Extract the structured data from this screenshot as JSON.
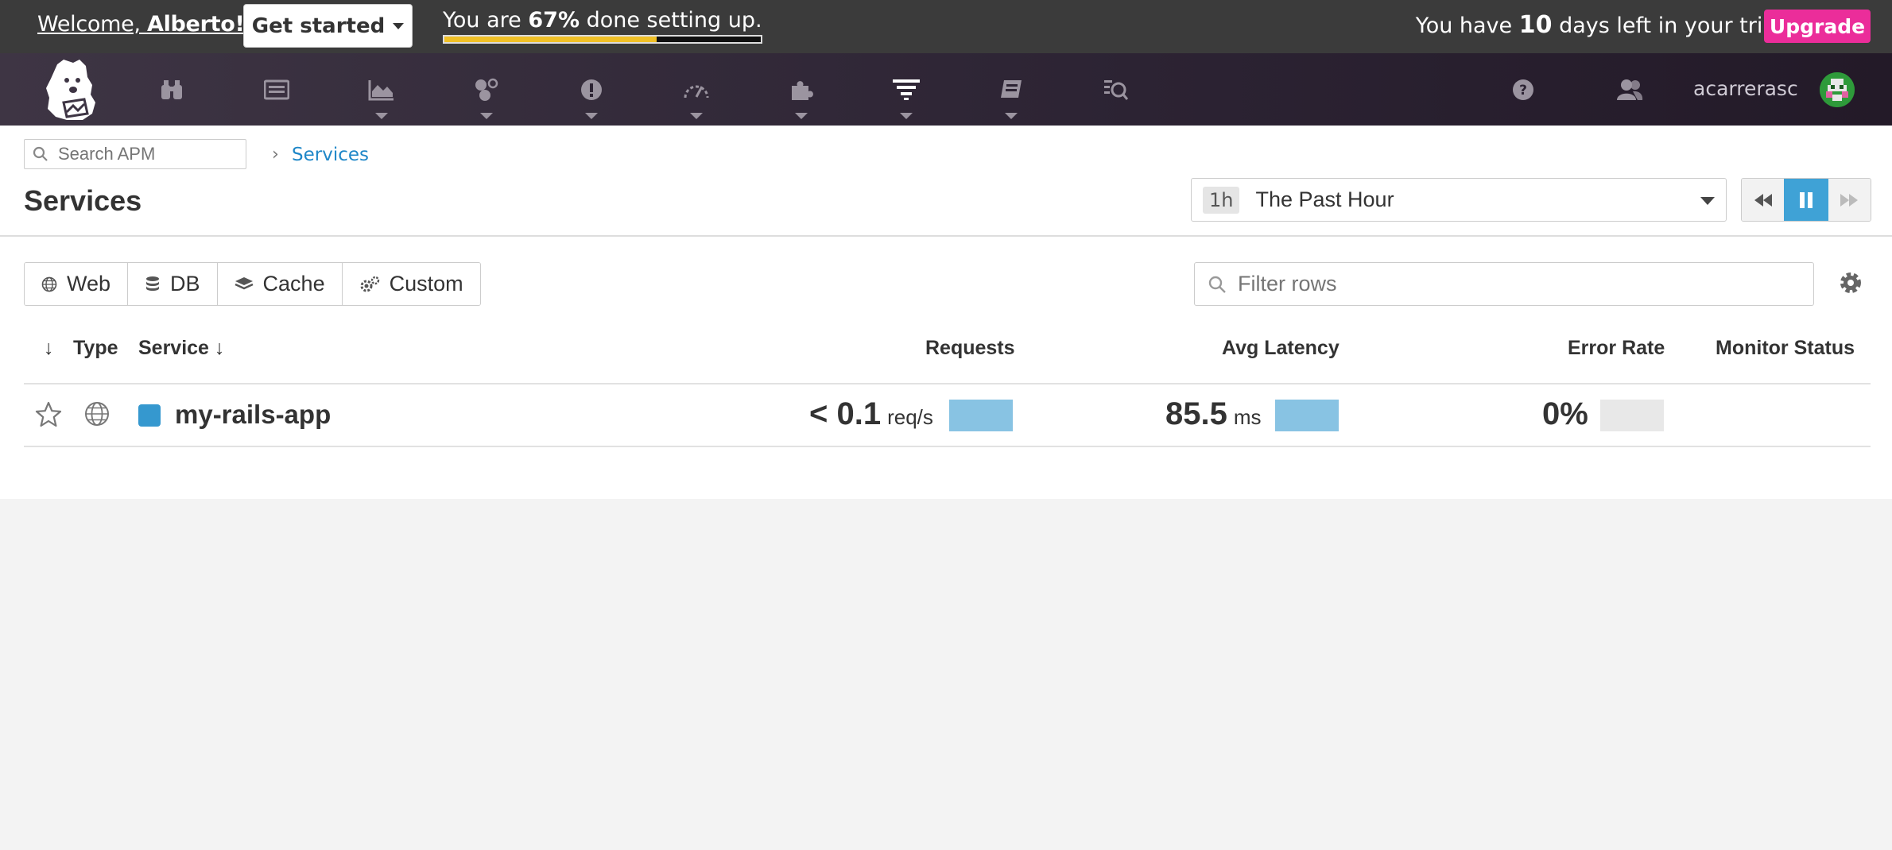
{
  "trial_bar": {
    "welcome_prefix": "Welcome, ",
    "welcome_name": "Alberto!",
    "get_started_label": "Get started",
    "setup_prefix": "You are ",
    "setup_percent": "67%",
    "setup_suffix": " done setting up.",
    "setup_progress_fraction": 0.67,
    "trial_prefix": "You have ",
    "trial_days": "10",
    "trial_suffix": " days left in your trial.",
    "upgrade_label": "Upgrade",
    "upgrade_color": "#eb2d9a",
    "progress_color": "#f0c026"
  },
  "nav": {
    "items": [
      {
        "icon": "binoculars-icon",
        "dropdown": false
      },
      {
        "icon": "dashboard-list-icon",
        "dropdown": true
      },
      {
        "icon": "area-chart-icon",
        "dropdown": true
      },
      {
        "icon": "infrastructure-hexagons-icon",
        "dropdown": true
      },
      {
        "icon": "monitors-alert-icon",
        "dropdown": true
      },
      {
        "icon": "speedometer-icon",
        "dropdown": true
      },
      {
        "icon": "puzzle-integrations-icon",
        "dropdown": true
      },
      {
        "icon": "apm-filter-lines-icon",
        "dropdown": true
      },
      {
        "icon": "notebook-icon",
        "dropdown": true
      },
      {
        "icon": "logs-search-icon",
        "dropdown": false
      }
    ],
    "help_icon": "question-circle-icon",
    "team_icon": "users-icon",
    "username": "acarrerasc"
  },
  "header": {
    "search_placeholder": "Search APM",
    "breadcrumb_link": "Services",
    "page_title": "Services",
    "time_badge": "1h",
    "time_label": "The Past Hour"
  },
  "filters": {
    "buttons": [
      {
        "label": "Web",
        "icon": "globe-icon"
      },
      {
        "label": "DB",
        "icon": "database-icon"
      },
      {
        "label": "Cache",
        "icon": "layers-icon"
      },
      {
        "label": "Custom",
        "icon": "gears-icon"
      }
    ],
    "filter_rows_placeholder": "Filter rows"
  },
  "table": {
    "columns": {
      "sort_arrow": "↓",
      "type": "Type",
      "service": "Service ↓",
      "requests": "Requests",
      "avg_latency": "Avg Latency",
      "error_rate": "Error Rate",
      "monitor_status": "Monitor Status"
    },
    "rows": [
      {
        "service": "my-rails-app",
        "service_color": "#3598cf",
        "requests_value": "< 0.1",
        "requests_unit": "req/s",
        "latency_value": "85.5",
        "latency_unit": "ms",
        "error_rate": "0%",
        "monitor_status": ""
      }
    ],
    "bar_colors": {
      "requests": "#88c3e3",
      "latency": "#88c3e3",
      "error_rate": "#e8e8e8"
    }
  }
}
